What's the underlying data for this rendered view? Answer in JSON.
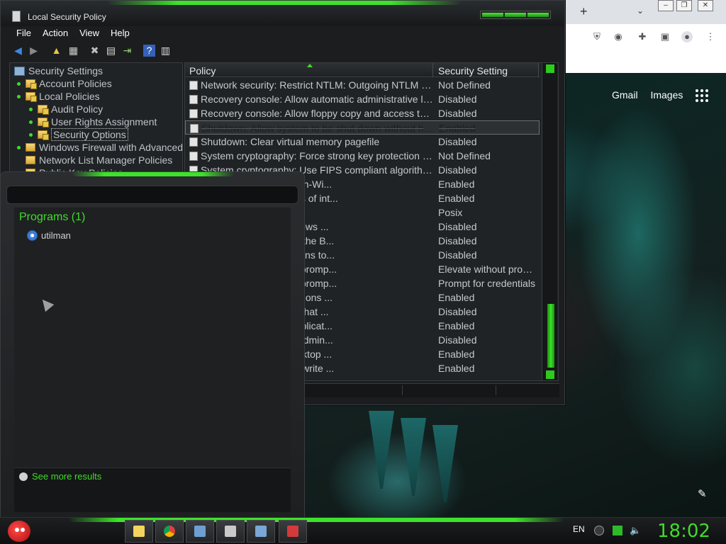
{
  "window": {
    "title": "Local Security Policy",
    "menu": [
      "File",
      "Action",
      "View",
      "Help"
    ]
  },
  "tree": {
    "items": [
      {
        "label": "Security Settings",
        "level": 0,
        "icon": "computer-icon",
        "bullet": false
      },
      {
        "label": "Account Policies",
        "level": 1,
        "icon": "folder-lock-icon",
        "bullet": true
      },
      {
        "label": "Local Policies",
        "level": 1,
        "icon": "folder-lock-icon",
        "bullet": true
      },
      {
        "label": "Audit Policy",
        "level": 2,
        "icon": "folder-lock-icon",
        "bullet": true
      },
      {
        "label": "User Rights Assignment",
        "level": 2,
        "icon": "folder-lock-icon",
        "bullet": true
      },
      {
        "label": "Security Options",
        "level": 2,
        "icon": "folder-lock-icon",
        "bullet": true,
        "selected": true
      },
      {
        "label": "Windows Firewall with Advanced S",
        "level": 1,
        "icon": "folder-icon",
        "bullet": true
      },
      {
        "label": "Network List Manager Policies",
        "level": 1,
        "icon": "folder-icon",
        "bullet": false
      },
      {
        "label": "Public Key Policies",
        "level": 1,
        "icon": "folder-icon",
        "bullet": false
      }
    ]
  },
  "list": {
    "columns": [
      "Policy",
      "Security Setting"
    ],
    "rows": [
      {
        "policy": "Network security: Restrict NTLM: Outgoing NTLM traff...",
        "setting": "Not Defined"
      },
      {
        "policy": "Recovery console: Allow automatic administrative logon",
        "setting": "Disabled"
      },
      {
        "policy": "Recovery console: Allow floppy copy and access to al...",
        "setting": "Disabled"
      },
      {
        "policy": "Shutdown: Allow system to be shut down without havi...",
        "setting": "Enabled",
        "highlight": true
      },
      {
        "policy": "Shutdown: Clear virtual memory pagefile",
        "setting": "Disabled"
      },
      {
        "policy": "System cryptography: Force strong key protection for...",
        "setting": "Not Defined"
      },
      {
        "policy": "System cryptography: Use FIPS compliant algorithms...",
        "setting": "Disabled"
      },
      {
        "policy": "case insensitivity for non-Wi...",
        "setting": "Enabled"
      },
      {
        "policy": "hen default permissions of int...",
        "setting": "Enabled"
      },
      {
        "policy": "al subsystems",
        "setting": "Posix"
      },
      {
        "policy": "rtificate Rules on Windows ...",
        "setting": "Disabled"
      },
      {
        "policy": "min Approval Mode for the B...",
        "setting": "Disabled"
      },
      {
        "policy": "low UIAccess applications to...",
        "setting": "Disabled"
      },
      {
        "policy": "havior of the elevation promp...",
        "setting": "Elevate without prom..."
      },
      {
        "policy": "havior of the elevation promp...",
        "setting": "Prompt for credentials"
      },
      {
        "policy": "tect application installations ...",
        "setting": "Enabled"
      },
      {
        "policy": "ly elevate executables that ...",
        "setting": "Disabled"
      },
      {
        "policy": "ly elevate UIAccess applicat...",
        "setting": "Enabled"
      },
      {
        "policy": "n all administrators in Admin...",
        "setting": "Disabled"
      },
      {
        "policy": "witch to the secure desktop ...",
        "setting": "Enabled"
      },
      {
        "policy": "tualize file and registry write ...",
        "setting": "Enabled"
      }
    ]
  },
  "start_menu": {
    "search_value": "",
    "programs_header": "Programs (1)",
    "program": "utilman",
    "see_more": "See more results"
  },
  "browser": {
    "links": [
      "Gmail",
      "Images"
    ]
  },
  "tray": {
    "language": "EN",
    "clock": "18:02"
  },
  "colors": {
    "accent": "#3dde26",
    "window_bg": "#1b1d1f"
  }
}
